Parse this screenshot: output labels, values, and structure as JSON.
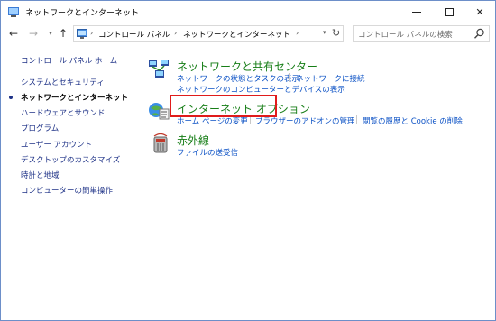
{
  "window": {
    "title": "ネットワークとインターネット"
  },
  "nav": {
    "back_icon": "back-arrow-icon",
    "forward_icon": "forward-arrow-icon",
    "up_icon": "up-arrow-icon"
  },
  "address": {
    "segments": [
      "コントロール パネル",
      "ネットワークとインターネット"
    ],
    "separator": "›",
    "leading_separator": "›"
  },
  "search": {
    "placeholder": "コントロール パネルの検索"
  },
  "sidebar": {
    "items": [
      {
        "label": "コントロール パネル ホーム",
        "current": false
      },
      {
        "label": "システムとセキュリティ",
        "current": false
      },
      {
        "label": "ネットワークとインターネット",
        "current": true
      },
      {
        "label": "ハードウェアとサウンド",
        "current": false
      },
      {
        "label": "プログラム",
        "current": false
      },
      {
        "label": "ユーザー アカウント",
        "current": false
      },
      {
        "label": "デスクトップのカスタマイズ",
        "current": false
      },
      {
        "label": "時計と地域",
        "current": false
      },
      {
        "label": "コンピューターの簡単操作",
        "current": false
      }
    ]
  },
  "categories": [
    {
      "title": "ネットワークと共有センター",
      "icon": "network-sharing-center-icon",
      "links": [
        "ネットワークの状態とタスクの表示",
        "ネットワークに接続",
        "ネットワークのコンピューターとデバイスの表示"
      ]
    },
    {
      "title": "インターネット オプション",
      "icon": "internet-options-icon",
      "links": [
        "ホーム ページの変更",
        "ブラウザーのアドオンの管理",
        "閲覧の履歴と Cookie の削除"
      ]
    },
    {
      "title": "赤外線",
      "icon": "infrared-icon",
      "links": [
        "ファイルの送受信"
      ]
    }
  ],
  "colors": {
    "category_title": "#177e17",
    "link": "#0b51c5",
    "sidebar_link": "#1e3287",
    "highlight": "#e01b1b"
  }
}
